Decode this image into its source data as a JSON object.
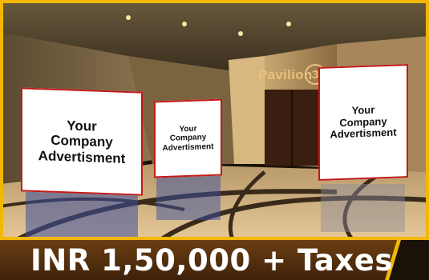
{
  "venue_sign": {
    "label": "Pavilion",
    "number": "3"
  },
  "panels": [
    {
      "text": "Your\nCompany\nAdvertisment"
    },
    {
      "text": "Your\nCompany\nAdvertisment"
    },
    {
      "text": "Your\nCompany\nAdvertisment"
    }
  ],
  "price": {
    "label": "INR 1,50,000 + Taxes"
  },
  "colors": {
    "frame_accent": "#f2b705",
    "panel_border": "#c21a1a",
    "price_bar": "#5a3410"
  }
}
